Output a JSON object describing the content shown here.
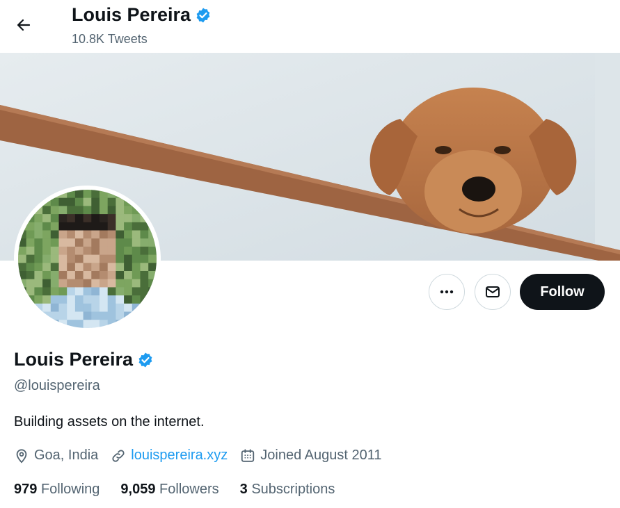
{
  "header": {
    "name": "Louis Pereira",
    "tweet_count": "10.8K Tweets"
  },
  "actions": {
    "follow_label": "Follow"
  },
  "profile": {
    "name": "Louis Pereira",
    "handle": "@louispereira",
    "bio": "Building assets on the internet.",
    "location": "Goa, India",
    "website": "louispereira.xyz",
    "joined": "Joined August 2011"
  },
  "stats": {
    "following_count": "979",
    "following_label": "Following",
    "followers_count": "9,059",
    "followers_label": "Followers",
    "subscriptions_count": "3",
    "subscriptions_label": "Subscriptions"
  },
  "icons": {
    "back": "arrow-left-icon",
    "verified": "verified-badge-icon",
    "more": "more-icon",
    "message": "envelope-icon",
    "location": "location-pin-icon",
    "link": "link-icon",
    "calendar": "calendar-icon"
  },
  "colors": {
    "accent": "#1d9bf0",
    "text": "#0f1419",
    "secondary": "#536471",
    "follow_bg": "#0f1419"
  }
}
